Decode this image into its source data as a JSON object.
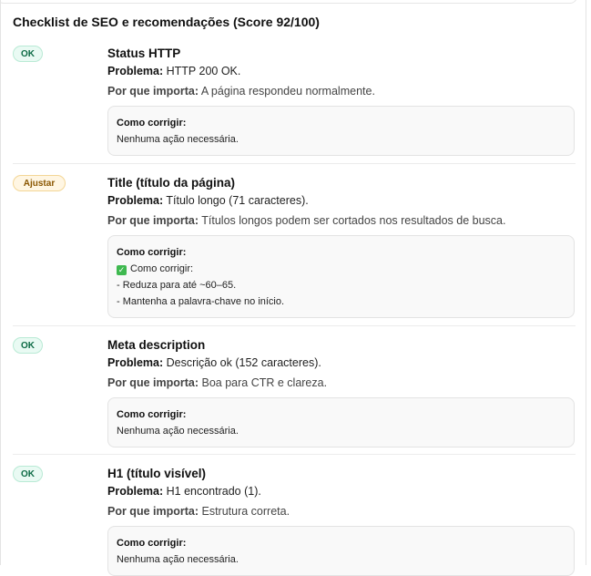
{
  "heading": "Checklist de SEO e recomendações (Score 92/100)",
  "labels": {
    "problem": "Problema:",
    "why": "Por que importa:",
    "fix": "Como corrigir:"
  },
  "items": [
    {
      "badge": "OK",
      "status": "ok",
      "title": "Status HTTP",
      "problem": "HTTP 200 OK.",
      "why": "A página respondeu normalmente.",
      "fix_lines": [
        "Nenhuma ação necessária."
      ]
    },
    {
      "badge": "Ajustar",
      "status": "warn",
      "title": "Title (título da página)",
      "problem": "Título longo (71 caracteres).",
      "why": "Títulos longos podem ser cortados nos resultados de busca.",
      "fix_check_text": "Como corrigir:",
      "fix_lines": [
        "- Reduza para até ~60–65.",
        "- Mantenha a palavra-chave no início."
      ]
    },
    {
      "badge": "OK",
      "status": "ok",
      "title": "Meta description",
      "problem": "Descrição ok (152 caracteres).",
      "why": "Boa para CTR e clareza.",
      "fix_lines": [
        "Nenhuma ação necessária."
      ]
    },
    {
      "badge": "OK",
      "status": "ok",
      "title": "H1 (título visível)",
      "problem": "H1 encontrado (1).",
      "why": "Estrutura correta.",
      "fix_lines": [
        "Nenhuma ação necessária."
      ]
    }
  ],
  "icons": {
    "check": "check-mark-icon"
  },
  "colors": {
    "ok_bg": "#e9faf3",
    "ok_text": "#0d6b45",
    "warn_bg": "#fff6e3",
    "warn_text": "#8a5600"
  }
}
